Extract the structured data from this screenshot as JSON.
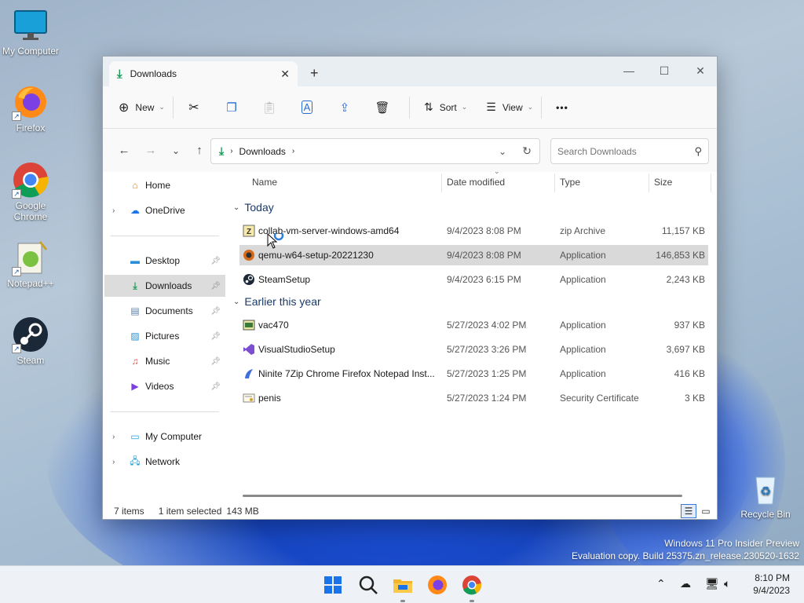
{
  "desktop": {
    "icons": [
      {
        "label": "My Computer"
      },
      {
        "label": "Firefox"
      },
      {
        "label": "Google Chrome"
      },
      {
        "label": "Notepad++"
      },
      {
        "label": "Steam"
      },
      {
        "label": "Recycle Bin"
      }
    ],
    "watermark_line1": "Windows 11 Pro Insider Preview",
    "watermark_line2": "Evaluation copy. Build 25375.zn_release.230520-1632"
  },
  "window": {
    "tab_title": "Downloads",
    "toolbar": {
      "new_label": "New",
      "sort_label": "Sort",
      "view_label": "View",
      "more_label": "•••"
    },
    "breadcrumb": {
      "current": "Downloads"
    },
    "search": {
      "placeholder": "Search Downloads"
    },
    "sidebar": {
      "home": "Home",
      "onedrive": "OneDrive",
      "pinned": [
        "Desktop",
        "Downloads",
        "Documents",
        "Pictures",
        "Music",
        "Videos"
      ],
      "my_computer": "My Computer",
      "network": "Network"
    },
    "columns": {
      "name": "Name",
      "date": "Date modified",
      "type": "Type",
      "size": "Size"
    },
    "groups": [
      {
        "label": "Today",
        "files": [
          {
            "name": "collab-vm-server-windows-amd64",
            "date": "9/4/2023 8:08 PM",
            "type": "zip Archive",
            "size": "11,157 KB"
          },
          {
            "name": "qemu-w64-setup-20221230",
            "date": "9/4/2023 8:08 PM",
            "type": "Application",
            "size": "146,853 KB"
          },
          {
            "name": "SteamSetup",
            "date": "9/4/2023 6:15 PM",
            "type": "Application",
            "size": "2,243 KB"
          }
        ]
      },
      {
        "label": "Earlier this year",
        "files": [
          {
            "name": "vac470",
            "date": "5/27/2023 4:02 PM",
            "type": "Application",
            "size": "937 KB"
          },
          {
            "name": "VisualStudioSetup",
            "date": "5/27/2023 3:26 PM",
            "type": "Application",
            "size": "3,697 KB"
          },
          {
            "name": "Ninite 7Zip Chrome Firefox Notepad Inst...",
            "date": "5/27/2023 1:25 PM",
            "type": "Application",
            "size": "416 KB"
          },
          {
            "name": "penis",
            "date": "5/27/2023 1:24 PM",
            "type": "Security Certificate",
            "size": "3 KB"
          }
        ]
      }
    ],
    "status": {
      "items": "7 items",
      "selected": "1 item selected",
      "selected_size": "143 MB"
    }
  },
  "taskbar": {
    "time": "8:10 PM",
    "date": "9/4/2023"
  },
  "colors": {
    "accent": "#1a73e8",
    "download_green": "#1b9a59",
    "selection": "#d9d9d9"
  }
}
